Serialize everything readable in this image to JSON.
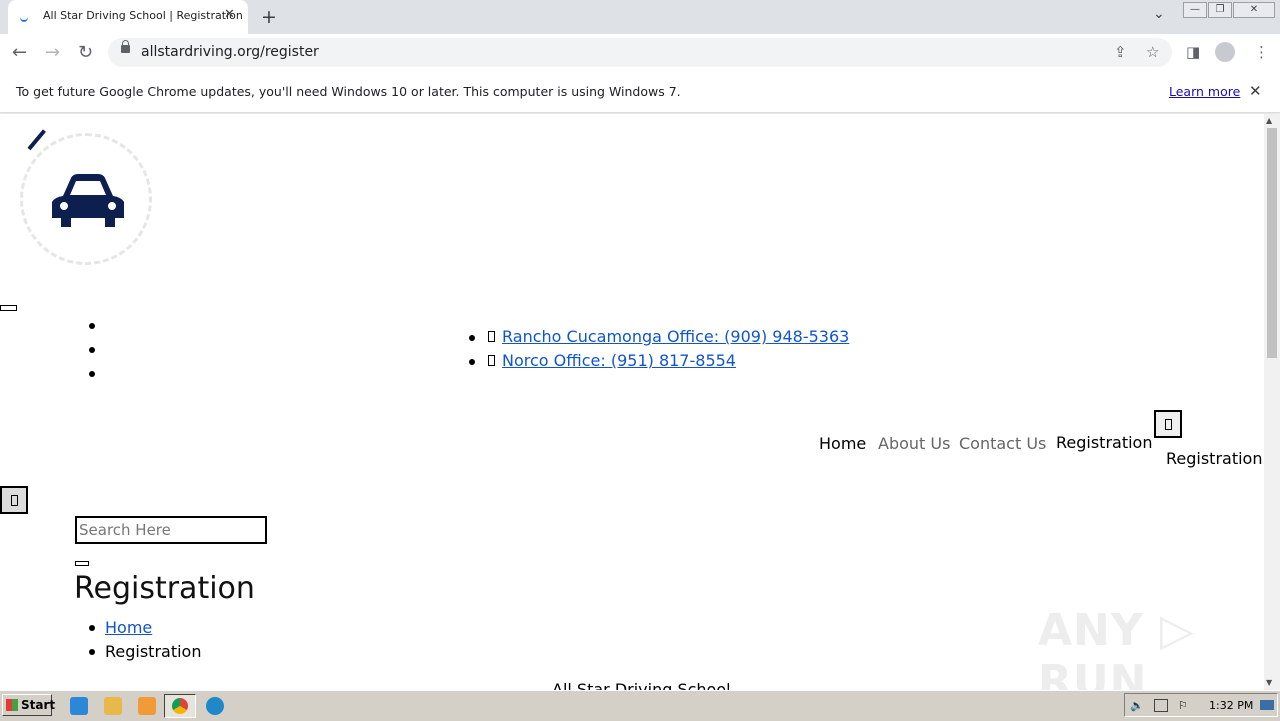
{
  "browser": {
    "tab_title": "All Star Driving School | Registration",
    "tab_close": "✕",
    "new_tab": "+",
    "url": "allstardriving.org/register",
    "back": "←",
    "forward": "→",
    "reload": "↻",
    "share": "⇪",
    "star": "☆",
    "sidebar": "◨",
    "menu": "⋮",
    "tab_search": "⌄",
    "win_min": "—",
    "win_restore": "❐",
    "win_close": "✕"
  },
  "infobar": {
    "message": "To get future Google Chrome updates, you'll need Windows 10 or later. This computer is using Windows 7.",
    "learn_more": "Learn more",
    "close": "✕"
  },
  "page": {
    "contacts": [
      {
        "label": "Rancho Cucamonga Office: (909) 948-5363"
      },
      {
        "label": "Norco Office: (951) 817-8554"
      }
    ],
    "nav": [
      {
        "label": "Home",
        "color": "#000000"
      },
      {
        "label": "About Us",
        "color": "#666666"
      },
      {
        "label": "Contact Us",
        "color": "#666666"
      },
      {
        "label": "Registration",
        "color": "#000000"
      }
    ],
    "nav_extra": "Registration",
    "search_placeholder": "Search Here",
    "heading": "Registration",
    "breadcrumb": [
      {
        "label": "Home"
      },
      {
        "label": "Registration"
      }
    ],
    "footer_partial": "All Star Driving School",
    "watermark": "ANY ▷ RUN"
  },
  "taskbar": {
    "start": "Start",
    "clock": "1:32 PM"
  },
  "colors": {
    "brand_navy": "#0c1f4e",
    "link": "#1155cc"
  }
}
